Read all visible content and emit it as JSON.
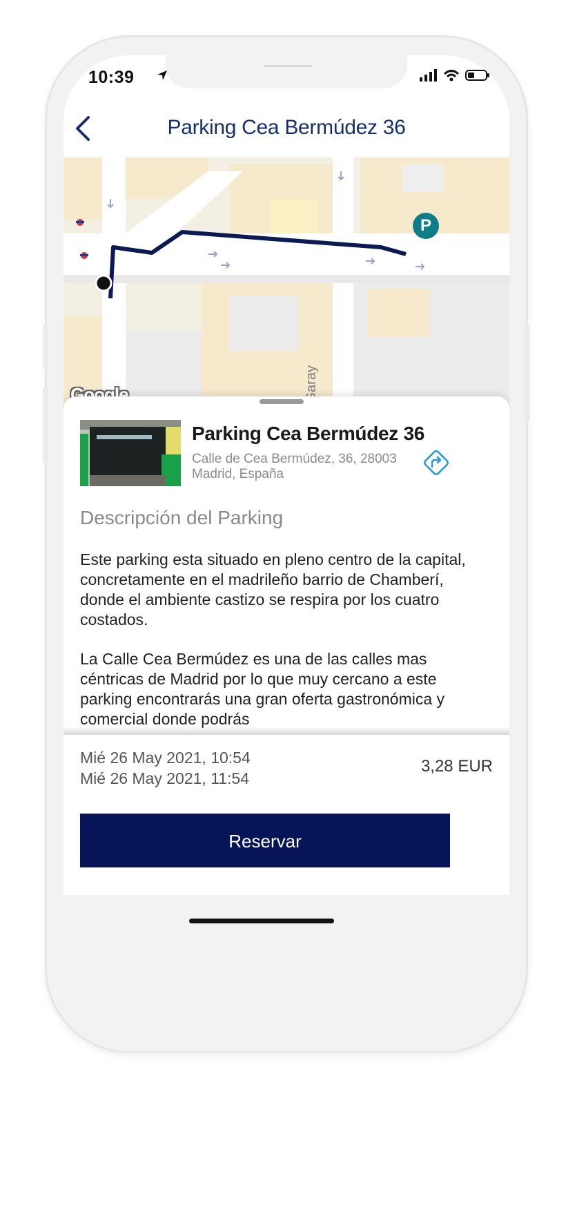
{
  "status_bar": {
    "time": "10:39",
    "icons": [
      "location-arrow-icon",
      "cellular-signal-icon",
      "wifi-icon",
      "battery-icon"
    ]
  },
  "header": {
    "back_icon": "chevron-left-icon",
    "title": "Parking Cea Bermúdez 36"
  },
  "map": {
    "logo_text": "Google",
    "street_label": "sco de Garay",
    "marker_label": "P",
    "route_color": "#0b1a52",
    "marker_color": "#0d7d86"
  },
  "parking": {
    "name": "Parking Cea Bermúdez 36",
    "address_line1": "Calle de Cea Bermúdez, 36, 28003",
    "address_line2": "Madrid, España",
    "directions_icon": "directions-icon"
  },
  "description": {
    "title": "Descripción del Parking",
    "paragraph1": "Este parking esta situado en pleno centro de la capital, concretamente en el madrileño barrio de Chamberí, donde el ambiente castizo se respira por los cuatro costados.",
    "paragraph2": "La Calle Cea Bermúdez es una de las calles mas céntricas de Madrid por lo que muy cercano a este parking encontrarás una gran oferta gastronómica y comercial donde podrás"
  },
  "booking": {
    "start": "Mié 26 May 2021, 10:54",
    "end": "Mié 26 May 2021, 11:54",
    "price": "3,28 EUR",
    "reserve_label": "Reservar",
    "button_color": "#061558"
  }
}
